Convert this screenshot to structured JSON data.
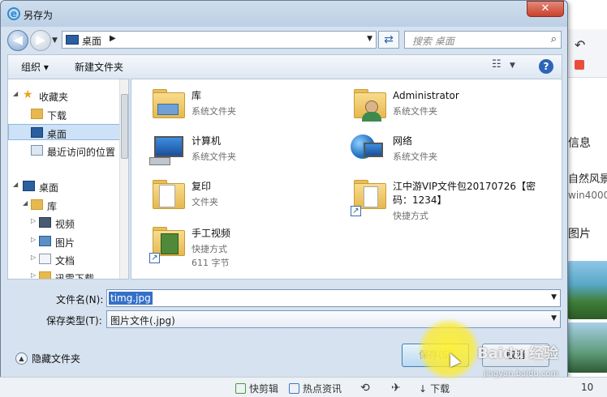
{
  "dialog": {
    "title": "另存为",
    "close": "✕"
  },
  "address": {
    "location": "桌面",
    "search_placeholder": "搜索 桌面"
  },
  "toolbar": {
    "organize": "组织 ▾",
    "new_folder": "新建文件夹"
  },
  "nav": {
    "items": [
      {
        "label": "收藏夹",
        "icon": "star-icon"
      },
      {
        "label": "下载",
        "icon": "download-folder-icon"
      },
      {
        "label": "桌面",
        "icon": "desktop-icon"
      },
      {
        "label": "最近访问的位置",
        "icon": "recent-places-icon"
      },
      {
        "label": "桌面",
        "icon": "desktop-icon"
      },
      {
        "label": "库",
        "icon": "library-icon"
      },
      {
        "label": "视频",
        "icon": "video-library-icon"
      },
      {
        "label": "图片",
        "icon": "pictures-library-icon"
      },
      {
        "label": "文档",
        "icon": "documents-library-icon"
      },
      {
        "label": "迅雷下载",
        "icon": "folder-icon"
      }
    ]
  },
  "files": [
    {
      "name": "库",
      "desc": "系统文件夹",
      "icon": "library-folder-icon"
    },
    {
      "name": "Administrator",
      "desc": "系统文件夹",
      "icon": "user-folder-icon"
    },
    {
      "name": "计算机",
      "desc": "系统文件夹",
      "icon": "computer-icon"
    },
    {
      "name": "网络",
      "desc": "系统文件夹",
      "icon": "network-icon"
    },
    {
      "name": "复印",
      "desc": "文件夹",
      "icon": "folder-icon"
    },
    {
      "name": "江中游VIP文件包20170726【密码：1234】",
      "desc": "快捷方式",
      "icon": "shortcut-folder-icon"
    },
    {
      "name": "手工视频",
      "desc": "快捷方式",
      "desc2": "611 字节",
      "icon": "shortcut-folder-icon"
    }
  ],
  "fields": {
    "filename_label": "文件名(N):",
    "filename_value": "timg.jpg",
    "filetype_label": "保存类型(T):",
    "filetype_value": "图片文件(.jpg)"
  },
  "footer": {
    "hide_folders": "隐藏文件夹",
    "save": "保存(S)",
    "cancel": "取消"
  },
  "browser_bg": {
    "text1": "信息",
    "text2": "自然风景",
    "text3": "win4000",
    "text4": "图片",
    "status": [
      "快剪辑",
      "热点资讯",
      "下载",
      "10"
    ]
  },
  "watermark": {
    "brand": "Baidu 经验",
    "url": "jingyan.baidu.com"
  },
  "colors": {
    "accent": "#3470c8",
    "highlight": "#ffeb28"
  }
}
